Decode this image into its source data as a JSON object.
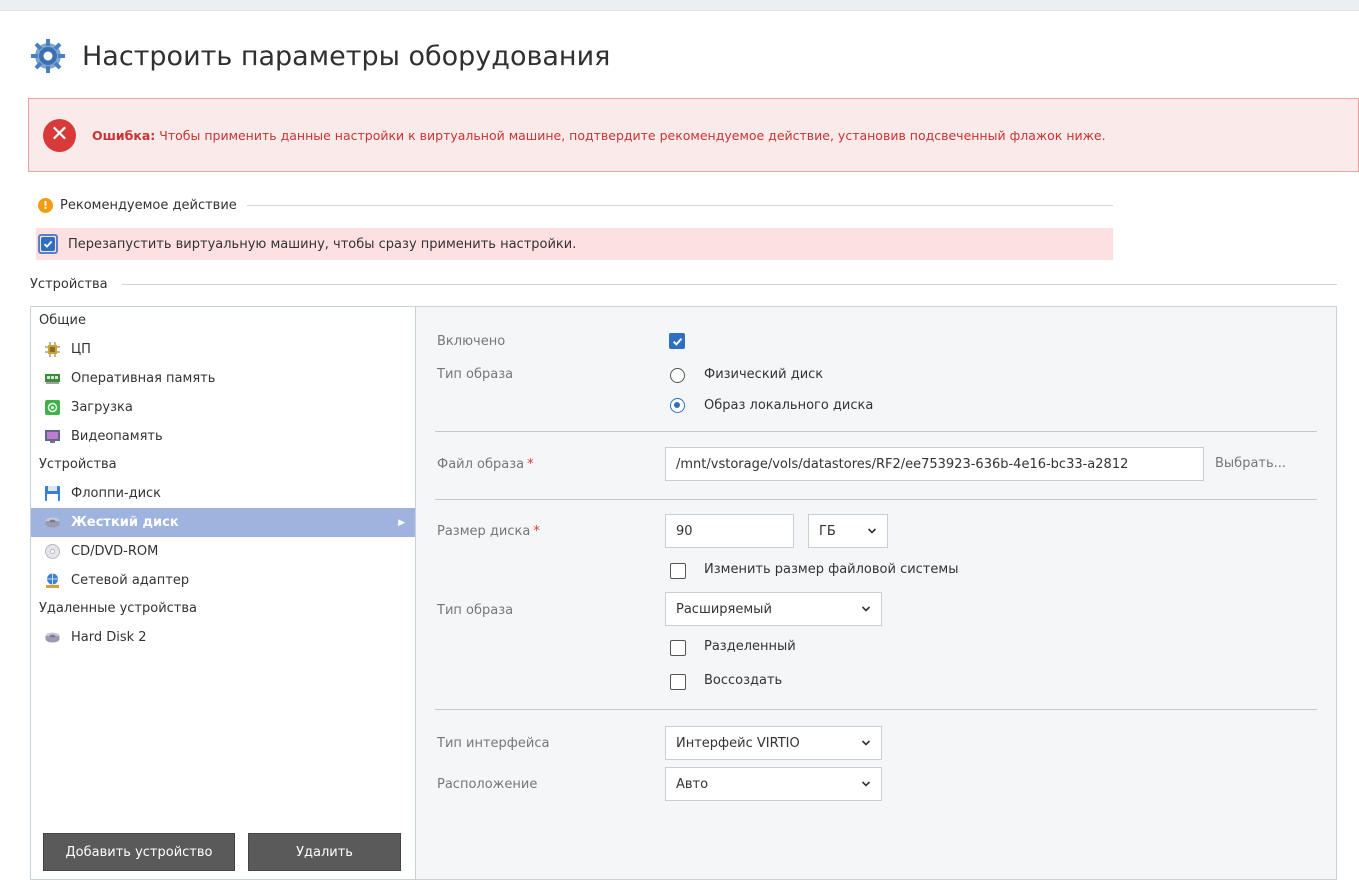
{
  "page": {
    "title": "Настроить параметры оборудования"
  },
  "error": {
    "prefix": "Ошибка:",
    "message": " Чтобы применить данные настройки к виртуальной машине, подтвердите рекомендуемое действие, установив подсвеченный флажок ниже."
  },
  "recommended": {
    "label": "Рекомендуемое действие",
    "restart_label": "Перезапустить виртуальную машину, чтобы сразу применить настройки.",
    "restart_checked": true
  },
  "devices": {
    "header": "Устройства",
    "groups": [
      {
        "label": "Общие",
        "items": [
          {
            "label": "ЦП",
            "icon": "cpu-icon"
          },
          {
            "label": "Оперативная память",
            "icon": "memory-icon"
          },
          {
            "label": "Загрузка",
            "icon": "boot-icon"
          },
          {
            "label": "Видеопамять",
            "icon": "video-memory-icon"
          }
        ]
      },
      {
        "label": "Устройства",
        "items": [
          {
            "label": "Флоппи-диск",
            "icon": "floppy-icon"
          },
          {
            "label": "Жесткий диск",
            "icon": "hard-disk-icon",
            "selected": true
          },
          {
            "label": "CD/DVD-ROM",
            "icon": "cdrom-icon"
          },
          {
            "label": "Сетевой адаптер",
            "icon": "network-icon"
          }
        ]
      },
      {
        "label": "Удаленные устройства",
        "items": [
          {
            "label": "Hard Disk 2",
            "icon": "hard-disk-icon"
          }
        ]
      }
    ],
    "add_button": "Добавить устройство",
    "delete_button": "Удалить"
  },
  "form": {
    "enabled_label": "Включено",
    "enabled_checked": true,
    "image_type_label": "Тип образа",
    "image_type_options": [
      "Физический диск",
      "Образ локального диска"
    ],
    "image_type_selected": 1,
    "image_file_label": "Файл образа",
    "image_file_value": "/mnt/vstorage/vols/datastores/RF2/ee753923-636b-4e16-bc33-a2812",
    "browse_label": "Выбрать...",
    "disk_size_label": "Размер диска",
    "disk_size_value": "90",
    "disk_size_unit": "ГБ",
    "resize_fs_label": "Изменить размер файловой системы",
    "resize_fs_checked": false,
    "image_kind_label": "Тип образа",
    "image_kind_value": "Расширяемый",
    "split_label": "Разделенный",
    "split_checked": false,
    "recreate_label": "Воссоздать",
    "recreate_checked": false,
    "interface_label": "Тип интерфейса",
    "interface_value": "Интерфейс VIRTIO",
    "location_label": "Расположение",
    "location_value": "Авто",
    "required_mark": "*"
  },
  "colors": {
    "accent": "#2f6fc2",
    "error": "#d83a3a",
    "selected_row": "#9fb3df"
  }
}
